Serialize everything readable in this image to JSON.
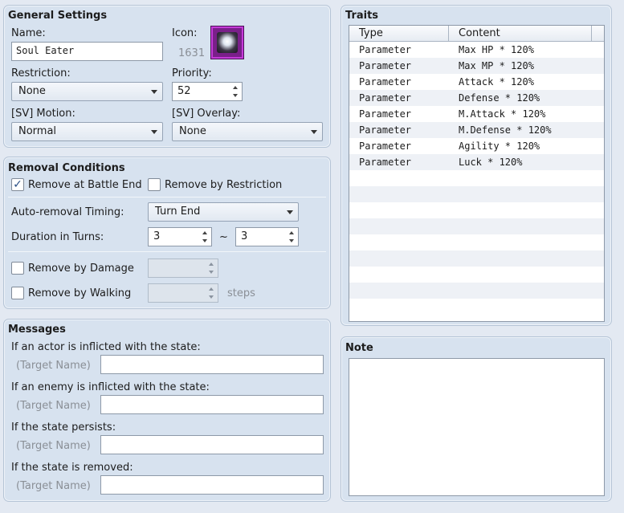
{
  "general": {
    "title": "General Settings",
    "name_label": "Name:",
    "name_value": "Soul Eater",
    "icon_label": "Icon:",
    "icon_index": "1631",
    "restriction_label": "Restriction:",
    "restriction_value": "None",
    "priority_label": "Priority:",
    "priority_value": "52",
    "motion_label": "[SV] Motion:",
    "motion_value": "Normal",
    "overlay_label": "[SV] Overlay:",
    "overlay_value": "None"
  },
  "removal": {
    "title": "Removal Conditions",
    "battle_end_label": "Remove at Battle End",
    "battle_end_checked": true,
    "restriction_label": "Remove by Restriction",
    "timing_label": "Auto-removal Timing:",
    "timing_value": "Turn End",
    "duration_label": "Duration in Turns:",
    "duration_min": "3",
    "duration_tilde": "~",
    "duration_max": "3",
    "damage_label": "Remove by Damage",
    "walking_label": "Remove by Walking",
    "steps_label": "steps"
  },
  "messages": {
    "title": "Messages",
    "actor_label": "If an actor is inflicted with the state:",
    "enemy_label": "If an enemy is inflicted with the state:",
    "persists_label": "If the state persists:",
    "removed_label": "If the state is removed:",
    "target_name": "(Target Name)"
  },
  "traits": {
    "title": "Traits",
    "col_type": "Type",
    "col_content": "Content",
    "rows": [
      {
        "type": "Parameter",
        "content": "Max HP * 120%"
      },
      {
        "type": "Parameter",
        "content": "Max MP * 120%"
      },
      {
        "type": "Parameter",
        "content": "Attack * 120%"
      },
      {
        "type": "Parameter",
        "content": "Defense * 120%"
      },
      {
        "type": "Parameter",
        "content": "M.Attack * 120%"
      },
      {
        "type": "Parameter",
        "content": "M.Defense * 120%"
      },
      {
        "type": "Parameter",
        "content": "Agility * 120%"
      },
      {
        "type": "Parameter",
        "content": "Luck * 120%"
      }
    ]
  },
  "note": {
    "title": "Note"
  }
}
